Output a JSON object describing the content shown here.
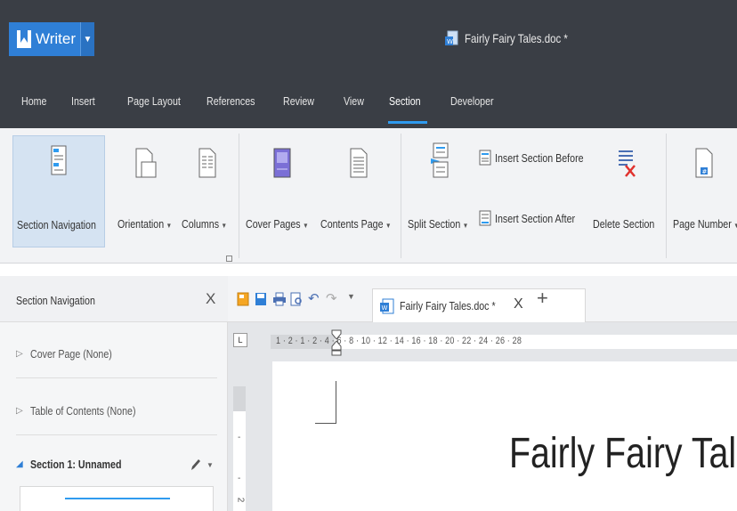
{
  "app": {
    "name": "Writer",
    "document_title": "Fairly Fairy Tales.doc *"
  },
  "menu": {
    "items": [
      "Home",
      "Insert",
      "Page Layout",
      "References",
      "Review",
      "View",
      "Section",
      "Developer"
    ],
    "active": "Section"
  },
  "ribbon": {
    "section_navigation": "Section Navigation",
    "orientation": "Orientation",
    "columns": "Columns",
    "cover_pages": "Cover Pages",
    "contents_page": "Contents Page",
    "split_section": "Split Section",
    "insert_section_before": "Insert Section Before",
    "insert_section_after": "Insert Section After",
    "delete_section": "Delete Section",
    "page_number": "Page Number"
  },
  "tab": {
    "title": "Fairly Fairy Tales.doc *",
    "close": "X",
    "new": "+"
  },
  "nav_panel": {
    "title": "Section Navigation",
    "close": "X",
    "items": [
      {
        "label": "Cover Page (None)"
      },
      {
        "label": "Table of Contents (None)"
      },
      {
        "label": "Section 1: Unnamed"
      }
    ]
  },
  "ruler": {
    "horizontal": "1 · 2 · 1 · 2 · 4 · 6 · 8 · 10 · 12 · 14 · 16 · 18 · 20 · 22 · 24 · 26 · 28",
    "corner": "L",
    "vertical_marks": [
      "-",
      "-",
      "2"
    ]
  },
  "document": {
    "heading": "Fairly Fairy Tale"
  },
  "colors": {
    "titlebar": "#3a3e45",
    "accent": "#2f7fd6",
    "tab_underline": "#2f9bef"
  }
}
